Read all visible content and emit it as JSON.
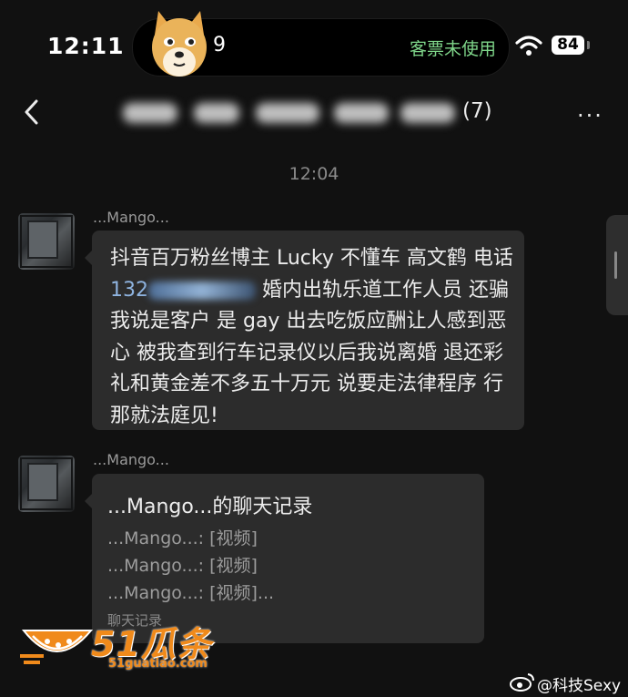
{
  "status_bar": {
    "time": "12:11",
    "island_number": "9",
    "island_text": "客票未使用",
    "battery": "84"
  },
  "nav": {
    "member_count": "(7)",
    "more_label": "···"
  },
  "timestamp": "12:04",
  "messages": [
    {
      "sender": "...Mango...",
      "text_before_phone": "抖音百万粉丝博主 Lucky 不懂车 高文鹤 电话",
      "phone_visible": "132",
      "text_after_phone": "婚内出轨乐道工作人员 还骗我说是客户 是 gay 出去吃饭应酬让人感到恶心 被我查到行车记录仪以后我说离婚 退还彩礼和黄金差不多五十万元 说要走法律程序 行 那就法庭见!"
    },
    {
      "sender": "...Mango...",
      "card_title": "...Mango...的聊天记录",
      "card_lines": [
        "...Mango...: [视频]",
        "...Mango...: [视频]",
        "...Mango...: [视频]..."
      ],
      "card_footer": "聊天记录"
    }
  ],
  "watermark": {
    "brand": "51瓜条",
    "domain": "51guatiao.com",
    "weibo_handle": "@科技Sexy"
  },
  "colors": {
    "background": "#111111",
    "bubble": "#2c2c2c",
    "island_text": "#7fd68a",
    "watermark_orange": "#f08a1b",
    "phone_link": "#8fb4e0"
  }
}
